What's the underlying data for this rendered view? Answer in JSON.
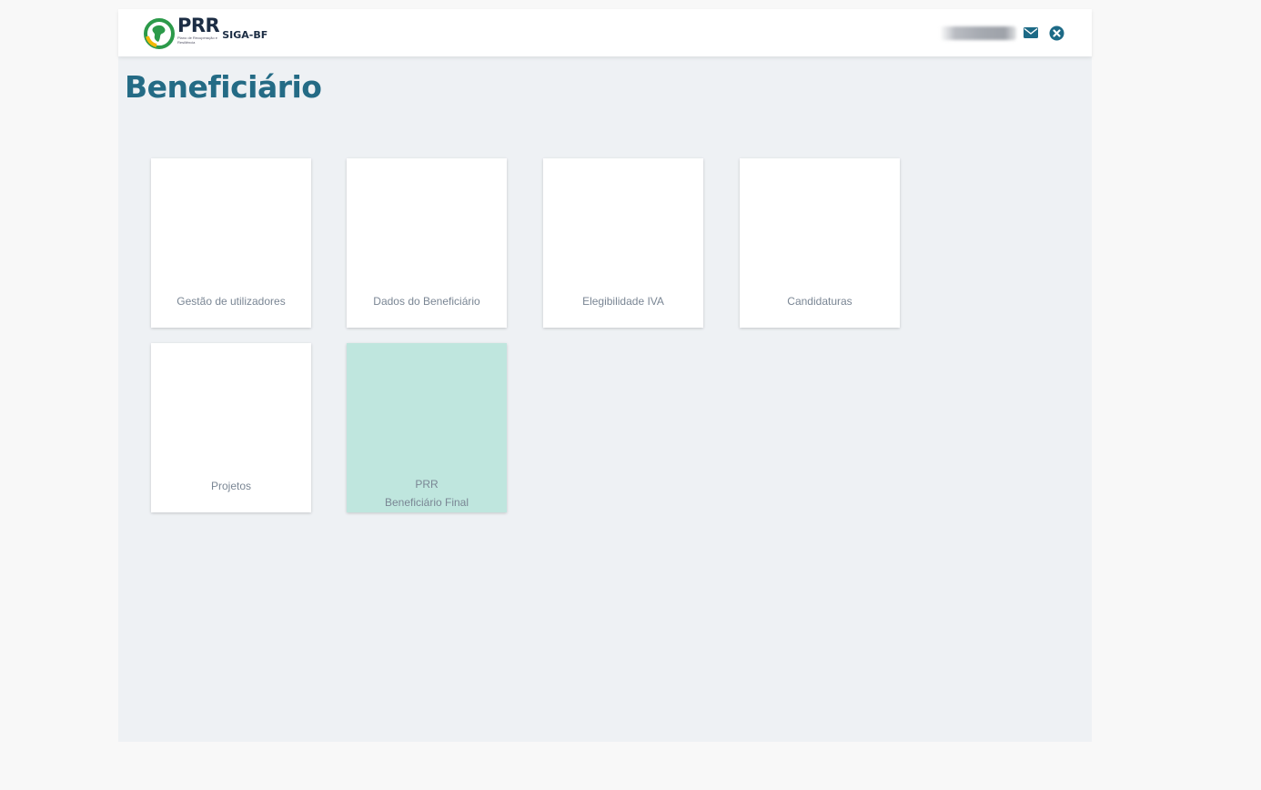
{
  "header": {
    "logo_brand": "PRR",
    "logo_tagline": "Plano de Recuperação e Resiliência",
    "app_name": "SIGA-BF",
    "icons": [
      "envelope-icon",
      "close-circle-icon"
    ],
    "accent_color": "#246b85"
  },
  "page": {
    "title": "Beneficiário"
  },
  "tiles": [
    {
      "label": "Gestão de utilizadores"
    },
    {
      "label": "Dados do Beneficiário"
    },
    {
      "label": "Elegibilidade IVA"
    },
    {
      "label": "Candidaturas"
    },
    {
      "label": "Projetos"
    },
    {
      "label_line1": "PRR",
      "label_line2": "Beneficiário Final",
      "active_color": "#bfe6de"
    }
  ]
}
